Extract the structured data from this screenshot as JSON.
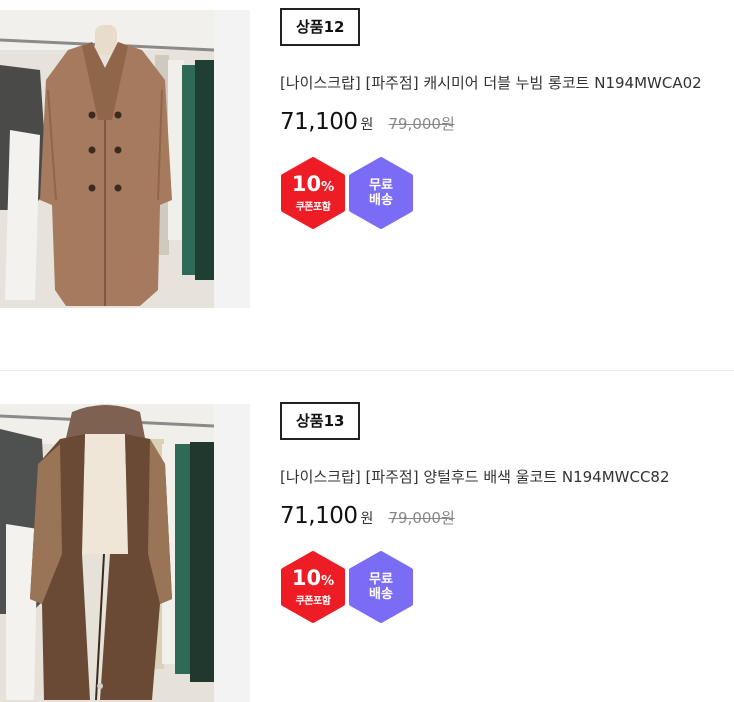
{
  "products": [
    {
      "tag": "상품12",
      "title": "[나이스크랍] [파주점] 캐시미어 더블 누빔 롱코트 N194MWCA02",
      "price": "71,100",
      "price_unit": "원",
      "original_price": "79,000원",
      "coupon_percent": "10",
      "coupon_percent_sign": "%",
      "coupon_label": "쿠폰포함",
      "shipping_line1": "무료",
      "shipping_line2": "배송",
      "image_icon": "camel-double-coat-image"
    },
    {
      "tag": "상품13",
      "title": "[나이스크랍] [파주점] 양털후드 배색 울코트 N194MWCC82",
      "price": "71,100",
      "price_unit": "원",
      "original_price": "79,000원",
      "coupon_percent": "10",
      "coupon_percent_sign": "%",
      "coupon_label": "쿠폰포함",
      "shipping_line1": "무료",
      "shipping_line2": "배송",
      "image_icon": "shearling-hood-coat-image"
    }
  ],
  "colors": {
    "coupon_badge": "#ee1c25",
    "shipping_badge": "#7b6cf6",
    "divider": "#e9e9e9"
  }
}
